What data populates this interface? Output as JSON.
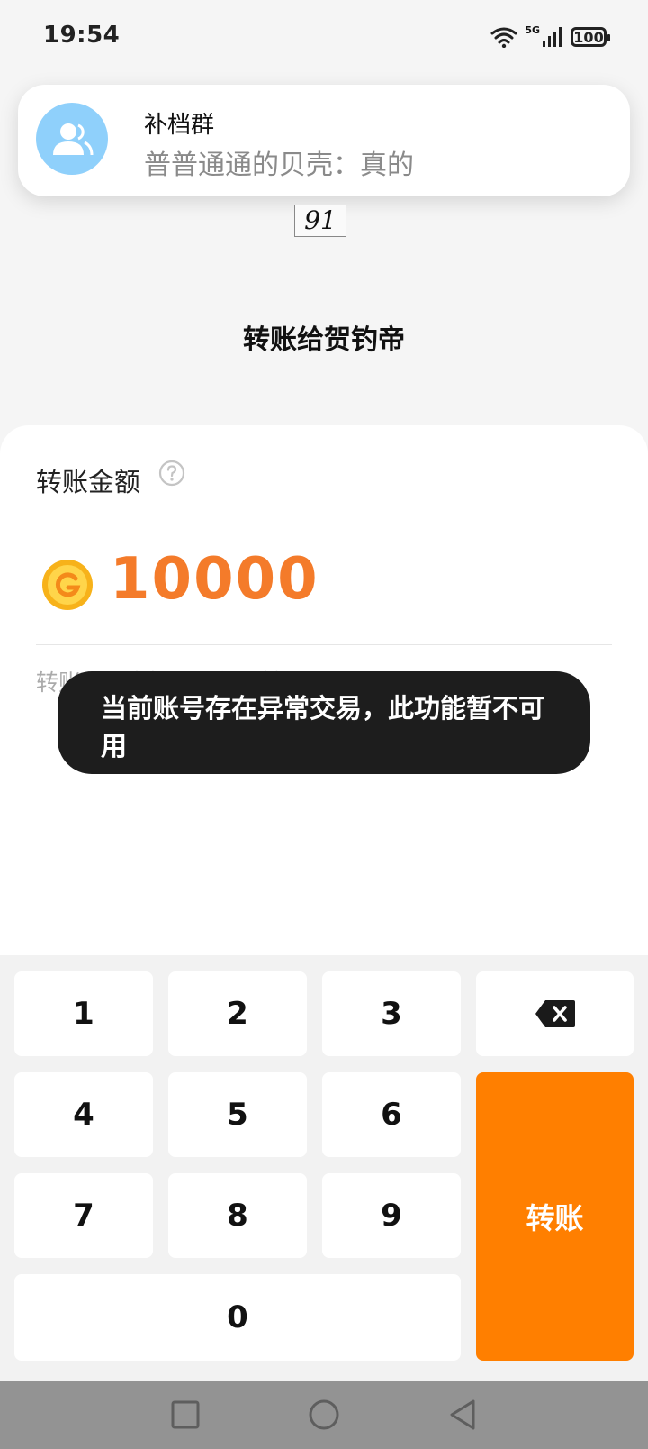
{
  "status_bar": {
    "time": "19:54",
    "network": "5G",
    "battery": "100"
  },
  "notification": {
    "group": "补档群",
    "message": "普普通通的贝壳：真的"
  },
  "captcha_text": "91",
  "page_title": "转账给贺钓帝",
  "amount": {
    "label": "转账金额",
    "value": "10000",
    "hint": "转账不可直接……使用转账"
  },
  "toast": {
    "message": "当前账号存在异常交易，此功能暂不可用"
  },
  "keypad": {
    "keys": [
      "1",
      "2",
      "3",
      "4",
      "5",
      "6",
      "7",
      "8",
      "9",
      "0"
    ],
    "submit_label": "转账",
    "delete_icon": "backspace-icon"
  },
  "colors": {
    "accent": "#ff7f00",
    "amount": "#f47b2a",
    "toast_bg": "#1d1d1d",
    "avatar": "#8fd0fb"
  }
}
